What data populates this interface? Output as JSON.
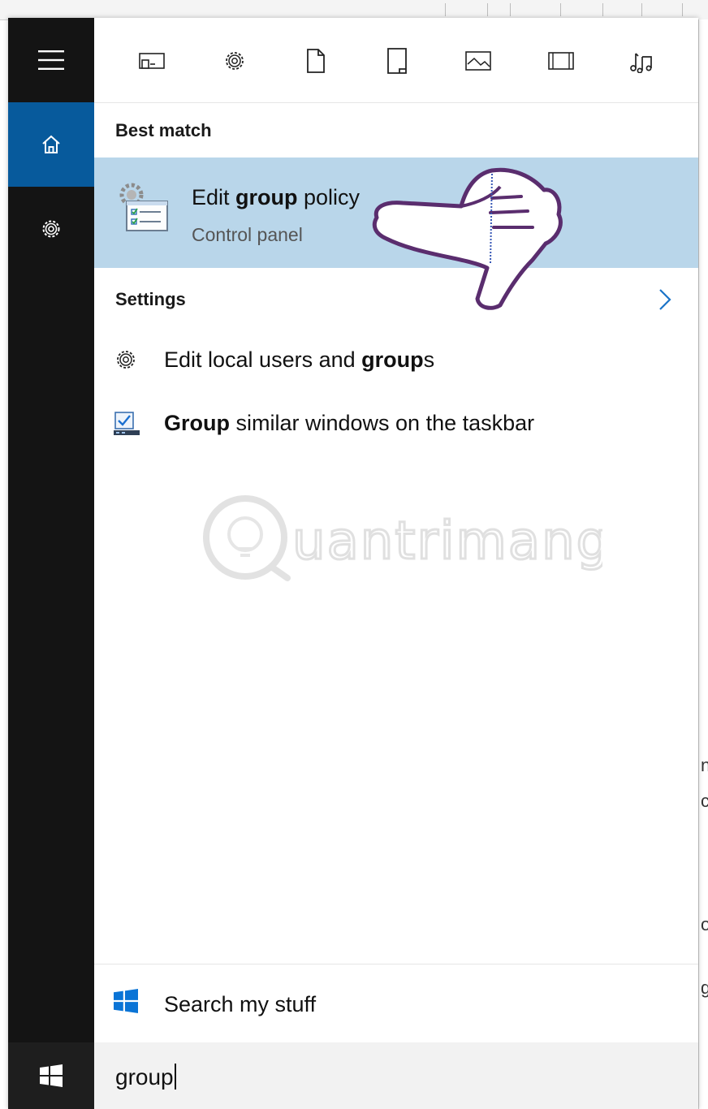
{
  "sidebar": {
    "items": [
      {
        "name": "menu",
        "icon": "hamburger-icon"
      },
      {
        "name": "home",
        "icon": "home-icon",
        "selected": true
      },
      {
        "name": "settings",
        "icon": "gear-icon"
      }
    ],
    "start_icon": "windows-logo-icon"
  },
  "filters": [
    {
      "icon": "apps-icon"
    },
    {
      "icon": "gear-icon"
    },
    {
      "icon": "document-icon"
    },
    {
      "icon": "folder-icon"
    },
    {
      "icon": "photo-icon"
    },
    {
      "icon": "video-icon"
    },
    {
      "icon": "music-icon"
    }
  ],
  "best_match": {
    "header": "Best match",
    "title_pre": "Edit ",
    "title_bold": "group",
    "title_post": " policy",
    "subtitle": "Control panel",
    "icon": "group-policy-icon"
  },
  "settings_section": {
    "header": "Settings",
    "items": [
      {
        "icon": "gear-icon",
        "pre": "Edit local users and ",
        "bold": "group",
        "post": "s"
      },
      {
        "icon": "taskbar-settings-icon",
        "pre": "",
        "bold": "Group",
        "post": " similar windows on the taskbar"
      }
    ]
  },
  "watermark": "Quantrimang",
  "search_my_stuff": "Search my stuff",
  "search_query": "group",
  "colors": {
    "sidebar": "#141414",
    "home_selected": "#075a9c",
    "highlight": "#b9d6ea",
    "pointer_outline": "#5a2d6e"
  },
  "background_fragments": [
    "n",
    "c",
    "o",
    "g"
  ]
}
